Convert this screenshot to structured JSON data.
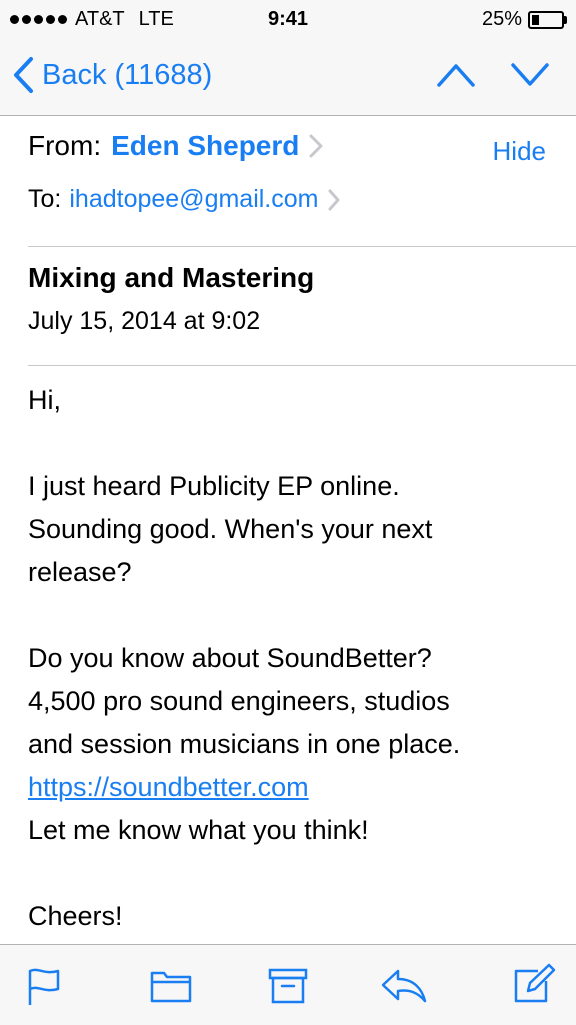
{
  "status_bar": {
    "carrier": "AT&T",
    "network": "LTE",
    "time": "9:41",
    "battery": "25%",
    "battery_level": 0.25
  },
  "nav": {
    "back_label": "Back (11688)"
  },
  "email": {
    "from_label": "From:",
    "from_name": "Eden Sheperd",
    "hide_label": "Hide",
    "to_label": "To:",
    "to_email": "ihadtopee@gmail.com",
    "subject": "Mixing and Mastering",
    "date": "July 15, 2014 at 9:02",
    "body": {
      "greeting": "Hi,",
      "p1_l1": "I just heard Publicity EP online.",
      "p1_l2": "Sounding good. When's your next",
      "p1_l3": "release?",
      "p2_l1": "Do you know about SoundBetter?",
      "p2_l2": "4,500 pro sound engineers, studios",
      "p2_l3": "and session musicians in one place.",
      "link": "https://soundbetter.com",
      "p2_l5": "Let me know what you think!",
      "signoff": "Cheers!"
    }
  },
  "colors": {
    "accent": "#1a7ef3",
    "bar_background": "#f7f7f7"
  },
  "icons": [
    "chevron-left-icon",
    "chevron-up-icon",
    "chevron-down-icon",
    "flag-icon",
    "folder-icon",
    "archive-icon",
    "reply-icon",
    "compose-icon"
  ]
}
